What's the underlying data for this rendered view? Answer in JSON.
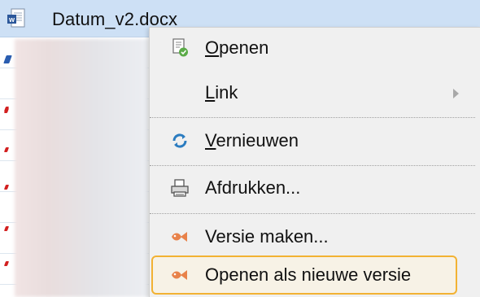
{
  "file_list": {
    "selected_file": "Datum_v2.docx"
  },
  "context_menu": {
    "items": [
      {
        "label_acc": "O",
        "label_rest": "penen",
        "icon": "open-document-icon"
      },
      {
        "label_acc": "L",
        "label_rest": "ink",
        "icon": "",
        "submenu": true
      },
      {
        "label_acc": "V",
        "label_rest": "ernieuwen",
        "icon": "refresh-icon"
      },
      {
        "label": "Afdrukken...",
        "icon": "printer-icon"
      },
      {
        "label": "Versie maken...",
        "icon": "version-icon"
      },
      {
        "label": "Openen als nieuwe versie",
        "icon": "version-icon",
        "highlighted": true
      }
    ]
  },
  "colors": {
    "selected_row": "#cde0f5",
    "menu_bg": "#f0f0f0",
    "highlight_border": "#f2b233",
    "version_icon": "#e8824a"
  }
}
